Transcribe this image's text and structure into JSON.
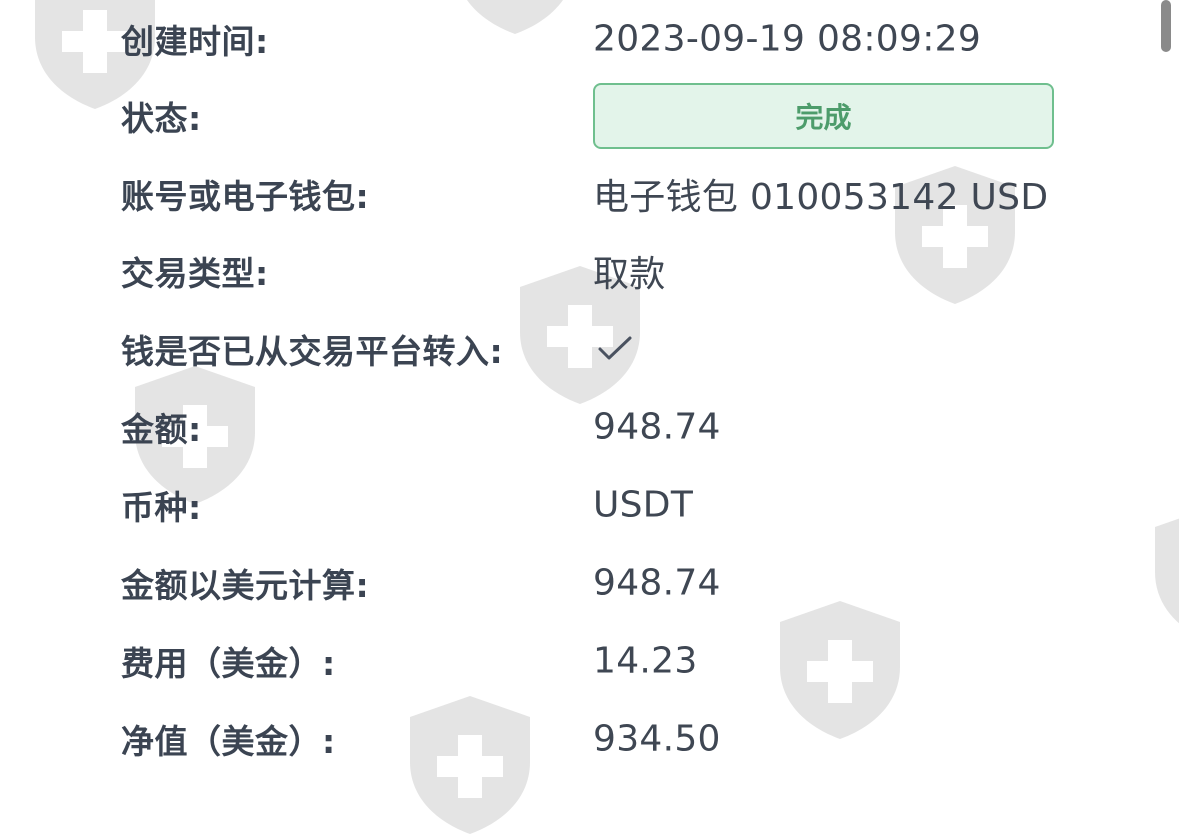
{
  "details": {
    "created_time": {
      "label": "创建时间:",
      "value": "2023-09-19 08:09:29"
    },
    "status": {
      "label": "状态:",
      "value": "完成"
    },
    "account": {
      "label": "账号或电子钱包:",
      "value": "电子钱包 010053142 USD"
    },
    "transaction_type": {
      "label": "交易类型:",
      "value": "取款"
    },
    "transferred": {
      "label": "钱是否已从交易平台转入:",
      "icon": "check-icon"
    },
    "amount": {
      "label": "金额:",
      "value": "948.74"
    },
    "currency": {
      "label": "币种:",
      "value": "USDT"
    },
    "amount_usd": {
      "label": "金额以美元计算:",
      "value": "948.74"
    },
    "fee": {
      "label": "费用（美金）:",
      "value": "14.23"
    },
    "net": {
      "label": "净值（美金）:",
      "value": "934.50"
    }
  },
  "colors": {
    "label": "#3b4452",
    "value": "#3f4753",
    "status_border": "#6fbf8e",
    "status_bg": "#e3f4ea",
    "status_text": "#4d9c6b"
  }
}
